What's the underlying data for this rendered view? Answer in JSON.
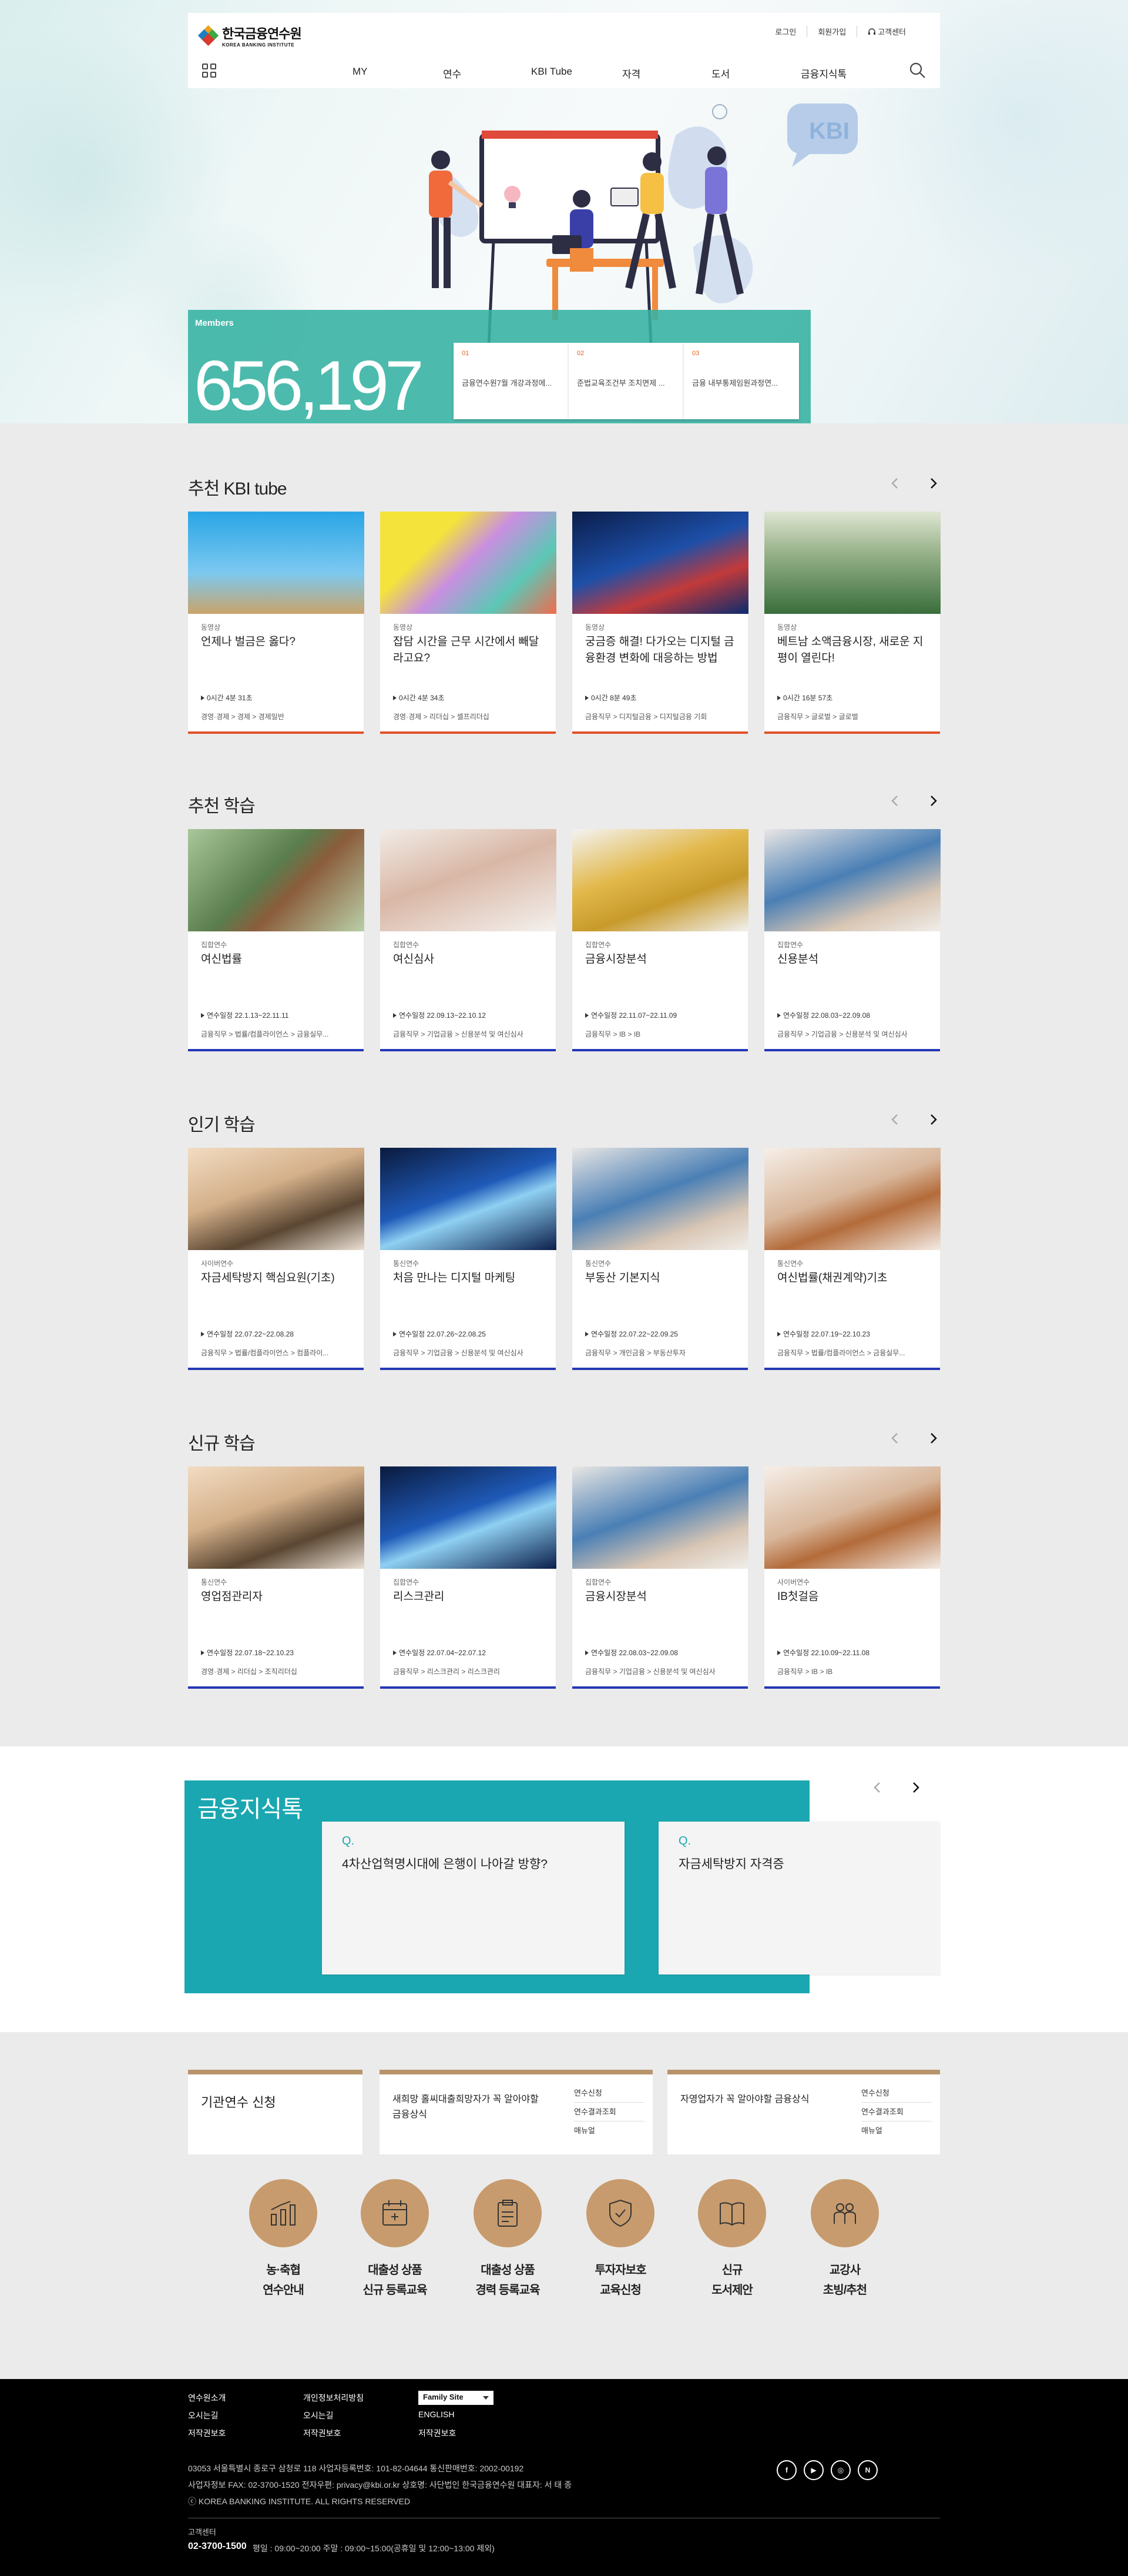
{
  "header": {
    "logo_ko": "한국금융연수원",
    "logo_en": "KOREA BANKING INSTITUTE",
    "util": [
      "로그인",
      "회원가입",
      "고객센터"
    ],
    "menu": [
      "MY",
      "연수",
      "KBI Tube",
      "자격",
      "도서",
      "금융지식톡"
    ]
  },
  "hero": {
    "badge": "KBI",
    "members_label": "Members",
    "members_count": "656,197",
    "notices": [
      {
        "num": "01",
        "title": "금융연수원7월 개강과정에..."
      },
      {
        "num": "02",
        "title": "준법교육조건부 조치면제 ..."
      },
      {
        "num": "03",
        "title": "금융 내부통제임원과정연..."
      }
    ]
  },
  "sections": [
    {
      "title": "추천 KBI tube",
      "cards": [
        {
          "cat": "동영상",
          "title": "언제나 벌금은 옳다?",
          "meta": "0시간 4분 31초",
          "path": "경영·경제 > 경제 > 경제일반"
        },
        {
          "cat": "동영상",
          "title": "잡담 시간을 근무 시간에서 빼달라고요?",
          "meta": "0시간 4분 34초",
          "path": "경영·경제 > 리더십 > 셀프리더십"
        },
        {
          "cat": "동영상",
          "title": "궁금증 해결! 다가오는 디지털 금융환경 변화에 대응하는 방법",
          "meta": "0시간 8분 49초",
          "path": "금융직무 > 디지털금융 > 디지털금융 기회"
        },
        {
          "cat": "동영상",
          "title": "베트남 소액금융시장, 새로운 지평이 열린다!",
          "meta": "0시간 16분 57초",
          "path": "금융직무 > 글로벌 > 글로벌"
        }
      ]
    },
    {
      "title": "추천 학습",
      "cards": [
        {
          "cat": "집합연수",
          "title": "여신법률",
          "meta": "연수일정 22.1.13~22.11.11",
          "path": "금융직무 > 법률/컴플라이언스 > 금융실무..."
        },
        {
          "cat": "집합연수",
          "title": "여신심사",
          "meta": "연수일정 22.09.13~22.10.12",
          "path": "금융직무 > 기업금융 > 신용분석 및 여신심사"
        },
        {
          "cat": "집합연수",
          "title": "금융시장분석",
          "meta": "연수일정 22.11.07~22.11.09",
          "path": "금융직무 > IB > IB"
        },
        {
          "cat": "집합연수",
          "title": "신용분석",
          "meta": "연수일정 22.08.03~22.09.08",
          "path": "금융직무 > 기업금융 > 신용분석 및 여신심사"
        }
      ]
    },
    {
      "title": "인기 학습",
      "cards": [
        {
          "cat": "사이버연수",
          "title": "자금세탁방지 핵심요원(기초)",
          "meta": "연수일정 22.07.22~22.08.28",
          "path": "금융직무 > 법률/컴플라이언스 > 컴플라이..."
        },
        {
          "cat": "통신연수",
          "title": "처음 만나는 디지털 마케팅",
          "meta": "연수일정 22.07.26~22.08.25",
          "path": "금융직무 > 기업금융 > 신용분석 및 여신심사"
        },
        {
          "cat": "통신연수",
          "title": "부동산 기본지식",
          "meta": "연수일정 22.07.22~22.09.25",
          "path": "금융직무 > 개인금융 > 부동산투자"
        },
        {
          "cat": "통신연수",
          "title": "여신법률(채권계약)기초",
          "meta": "연수일정 22.07.19~22.10.23",
          "path": "금융직무 > 법률/컴플라이언스 > 금융실무..."
        }
      ]
    },
    {
      "title": "신규 학습",
      "cards": [
        {
          "cat": "통신연수",
          "title": "영업점관리자",
          "meta": "연수일정 22.07.18~22.10.23",
          "path": "경영·경제 > 리더십 > 조직리더십"
        },
        {
          "cat": "집합연수",
          "title": "리스크관리",
          "meta": "연수일정 22.07.04~22.07.12",
          "path": "금융직무 > 리스크관리 > 리스크관리"
        },
        {
          "cat": "집합연수",
          "title": "금융시장분석",
          "meta": "연수일정 22.08.03~22.09.08",
          "path": "금융직무 > 기업금융 > 신용분석 및 여신심사"
        },
        {
          "cat": "사이버연수",
          "title": "IB첫걸음",
          "meta": "연수일정 22.10.09~22.11.08",
          "path": "금융직무 > IB > IB"
        }
      ]
    }
  ],
  "finance_talk": {
    "title": "금융지식톡",
    "q_mark": "Q.",
    "questions": [
      "4차산업혁명시대에 은행이 나아갈 방향?",
      "자금세탁방지 자격증"
    ]
  },
  "info_boxes": [
    {
      "title": "기관연수 신청",
      "links": []
    },
    {
      "title": "새희망 홀씨대출희망자가 꼭 알아야할 금융상식",
      "links": [
        "연수신청",
        "연수결과조회",
        "매뉴얼"
      ]
    },
    {
      "title": "자영업자가 꼭 알아야할 금융상식",
      "links": [
        "연수신청",
        "연수결과조회",
        "매뉴얼"
      ]
    }
  ],
  "quick_links": [
    {
      "line1": "농·축협",
      "line2": "연수안내",
      "icon": "chart-icon"
    },
    {
      "line1": "대출성 상품",
      "line2": "신규 등록교육",
      "icon": "calendar-icon"
    },
    {
      "line1": "대출성 상품",
      "line2": "경력 등록교육",
      "icon": "clipboard-icon"
    },
    {
      "line1": "투자자보호",
      "line2": "교육신청",
      "icon": "shield-icon"
    },
    {
      "line1": "신규",
      "line2": "도서제안",
      "icon": "book-icon"
    },
    {
      "line1": "교강사",
      "line2": "초빙/추천",
      "icon": "people-icon"
    }
  ],
  "footer": {
    "col1": [
      "연수원소개",
      "오시는길",
      "저작권보호"
    ],
    "col2": [
      "개인정보처리방침",
      "오시는길",
      "저작권보호"
    ],
    "col3": [
      "ENGLISH",
      "저작권보호"
    ],
    "family_site": "Family Site",
    "address": "03053 서울특별시 종로구 삼청로 118 사업자등록번호: 101-82-04644 통신판매번호: 2002-00192",
    "contact": "사업자정보 FAX: 02-3700-1520 전자우편: privacy@kbi.or.kr 상호명: 사단법인 한국금융연수원 대표자: 서 태 종",
    "copyright": "ⓒ KOREA BANKING INSTITUTE. ALL RIGHTS RESERVED",
    "cs_label": "고객센터",
    "cs_phone": "02-3700-1500",
    "cs_hours": "평일 : 09:00~20:00 주말 : 09:00~15:00(공휴일 및 12:00~13:00 제외)",
    "sns": [
      "f",
      "▶",
      "◎",
      "N"
    ]
  },
  "colors": {
    "teal": "#1ba7b1",
    "members": "#34b2a2",
    "orange": "#e0522b",
    "blue": "#2538b5",
    "gold": "#c79b6d"
  }
}
